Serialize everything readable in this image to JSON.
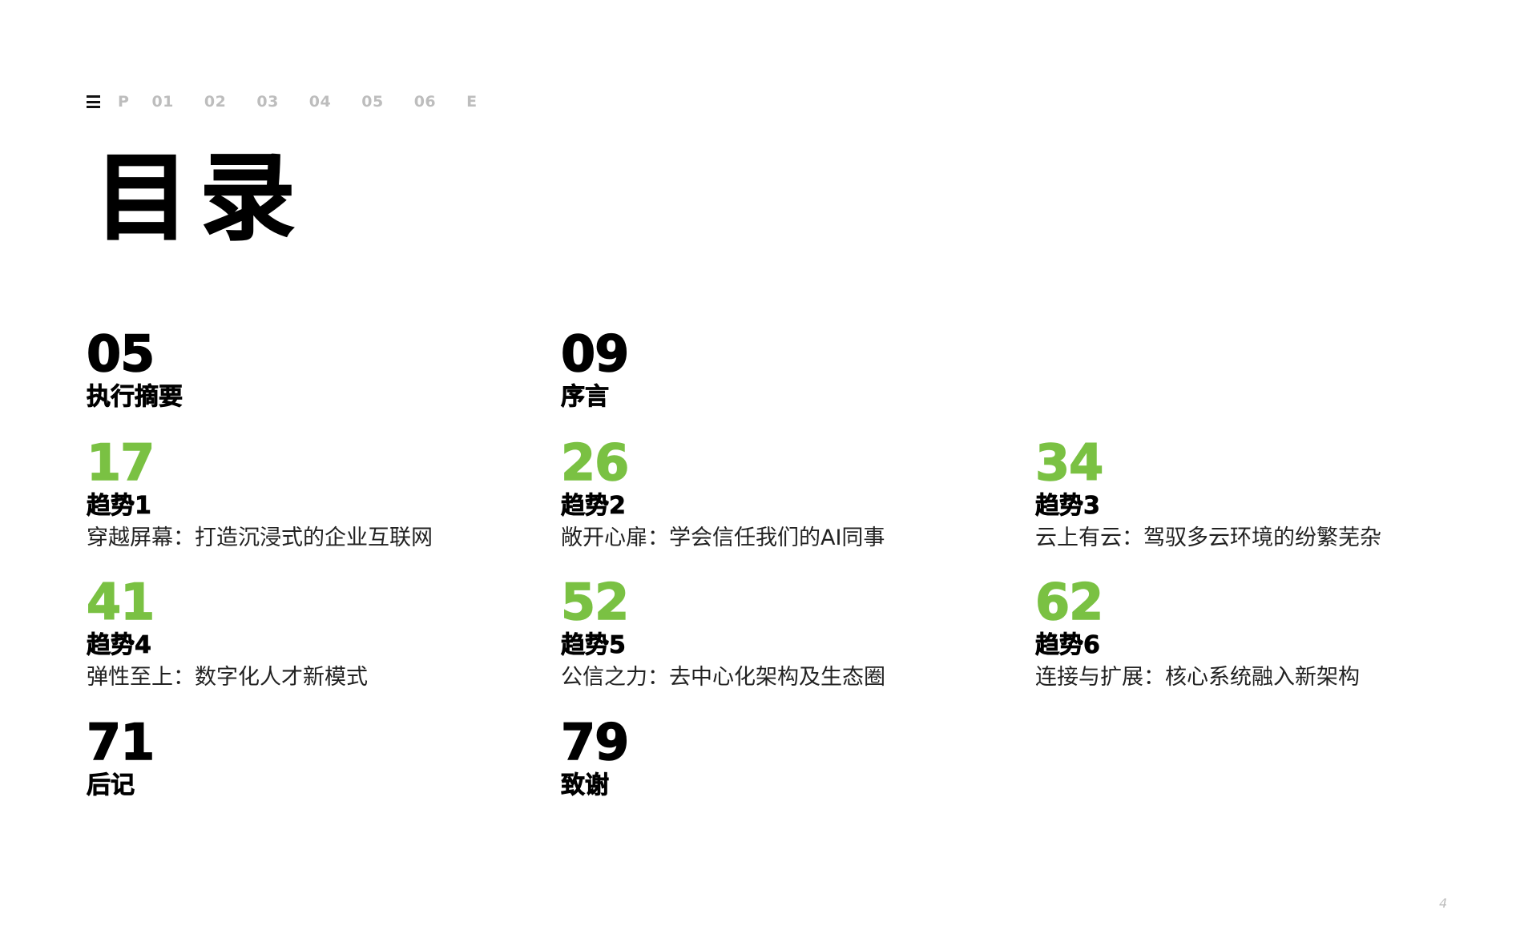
{
  "nav": {
    "menu_icon": "hamburger-menu-icon",
    "items": [
      "P",
      "01",
      "02",
      "03",
      "04",
      "05",
      "06",
      "E"
    ]
  },
  "title": "目录",
  "colors": {
    "accent": "#7ac143",
    "text": "#000000",
    "muted": "#bdbdbd"
  },
  "toc": [
    {
      "number": "05",
      "heading": "执行摘要",
      "subtitle": "",
      "color": "black"
    },
    {
      "number": "09",
      "heading": "序言",
      "subtitle": "",
      "color": "black"
    },
    {
      "number": "17",
      "heading": "趋势1",
      "subtitle": "穿越屏幕：打造沉浸式的企业互联网",
      "color": "green"
    },
    {
      "number": "26",
      "heading": "趋势2",
      "subtitle": "敞开心扉：学会信任我们的AI同事",
      "color": "green"
    },
    {
      "number": "34",
      "heading": "趋势3",
      "subtitle": "云上有云：驾驭多云环境的纷繁芜杂",
      "color": "green"
    },
    {
      "number": "41",
      "heading": "趋势4",
      "subtitle": "弹性至上：数字化人才新模式",
      "color": "green"
    },
    {
      "number": "52",
      "heading": "趋势5",
      "subtitle": "公信之力：去中心化架构及生态圈",
      "color": "green"
    },
    {
      "number": "62",
      "heading": "趋势6",
      "subtitle": "连接与扩展：核心系统融入新架构",
      "color": "green"
    },
    {
      "number": "71",
      "heading": "后记",
      "subtitle": "",
      "color": "black"
    },
    {
      "number": "79",
      "heading": "致谢",
      "subtitle": "",
      "color": "black"
    }
  ],
  "page_number": "4"
}
